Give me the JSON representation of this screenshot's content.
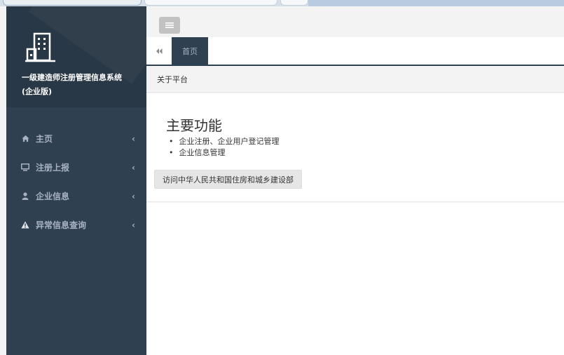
{
  "sidebar": {
    "logo_icon": "building-icon",
    "title_line1": "一级建造师注册管理信息系统",
    "title_line2": "(企业版)",
    "items": [
      {
        "icon": "home-icon",
        "label": "主页",
        "chevron": "‹"
      },
      {
        "icon": "monitor-icon",
        "label": "注册上报",
        "chevron": "‹"
      },
      {
        "icon": "user-icon",
        "label": "企业信息",
        "chevron": "‹"
      },
      {
        "icon": "warning-icon",
        "label": "异常信息查询",
        "chevron": "‹"
      }
    ]
  },
  "topbar": {
    "menu_icon": "hamburger-icon"
  },
  "tabs": {
    "back_icon": "double-left-icon",
    "home_label": "首页"
  },
  "breadcrumb": {
    "label": "关于平台"
  },
  "content": {
    "heading": "主要功能",
    "features": [
      "企业注册、企业用户登记管理",
      "企业信息管理"
    ],
    "visit_button": "访问中华人民共和国住房和城乡建设部"
  },
  "colors": {
    "sidebar_bg": "#2f4050",
    "sidebar_header_bg": "#293846",
    "nav_text": "#a7b1c2"
  }
}
